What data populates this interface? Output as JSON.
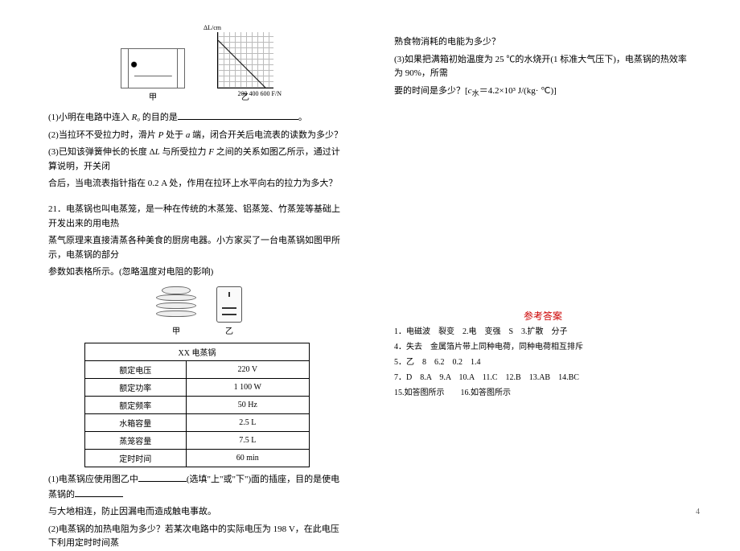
{
  "fig1": {
    "axis_x": "200 400 600 F/N",
    "axis_y": "ΔL/cm",
    "label_left": "甲",
    "label_right": "乙"
  },
  "q20": {
    "line1_a": "(1)小明在电路中连入 ",
    "line1_b": "R₀",
    "line1_c": " 的目的是",
    "line1_d": "。",
    "line2_a": "(2)当拉环不受拉力时，滑片 ",
    "line2_b": "P",
    "line2_c": " 处于 ",
    "line2_d": "a",
    "line2_e": " 端，闭合开关后电流表的读数为多少？",
    "line3_a": "(3)已知该弹簧伸长的长度 Δ",
    "line3_b": "L",
    "line3_c": " 与所受拉力 ",
    "line3_d": "F",
    "line3_e": " 之间的关系如图乙所示，通过计算说明，开关闭",
    "line3_f": "合后，当电流表指针指在 0.2 A 处，作用在拉环上水平向右的拉力为多大？"
  },
  "q21": {
    "para1": "21．电蒸锅也叫电蒸笼，是一种在传统的木蒸笼、铝蒸笼、竹蒸笼等基础上开发出来的用电热",
    "para2": "蒸气原理来直接清蒸各种美食的厨房电器。小方家买了一台电蒸锅如图甲所示，电蒸锅的部分",
    "para3": "参数如表格所示。(忽略温度对电阻的影响)",
    "fig_left": "甲",
    "fig_right": "乙",
    "line1_a": "(1)电蒸锅应使用图乙中",
    "line1_b": "(选填\"上\"或\"下\")面的插座，目的是使电蒸锅的",
    "line1_c": "与大地相连，防止因漏电而造成触电事故。",
    "line2": "(2)电蒸锅的加热电阻为多少？若某次电路中的实际电压为 198 V，在此电压下利用定时时间蒸"
  },
  "spec": {
    "title": "XX 电蒸锅",
    "r1k": "额定电压",
    "r1v": "220 V",
    "r2k": "额定功率",
    "r2v": "1 100 W",
    "r3k": "额定频率",
    "r3v": "50 Hz",
    "r4k": "水箱容量",
    "r4v": "2.5 L",
    "r5k": "蒸笼容量",
    "r5v": "7.5 L",
    "r6k": "定时时间",
    "r6v": "60 min"
  },
  "right": {
    "line1": "熟食物消耗的电能为多少？",
    "line2": "(3)如果把满箱初始温度为 25 ℃的水烧开(1 标准大气压下)，电蒸锅的热效率为 90%，所需",
    "line3_a": "要的时间是多少？[",
    "line3_b": "c",
    "line3_c": "水",
    "line3_d": "＝4.2×10³ J/(kg· ℃)]"
  },
  "answers": {
    "title": "参考答案",
    "a1": "1．电磁波　裂变　2.电　变强　S　3.扩散　分子",
    "a2": "4．失去　金属箔片带上同种电荷，同种电荷相互排斥",
    "a3": "5．乙　8　6.2　0.2　1.4",
    "a4": "7．D　8.A　9.A　10.A　11.C　12.B　13.AB　14.BC",
    "a5": "15.如答图所示　　16.如答图所示"
  },
  "page_number": "4"
}
